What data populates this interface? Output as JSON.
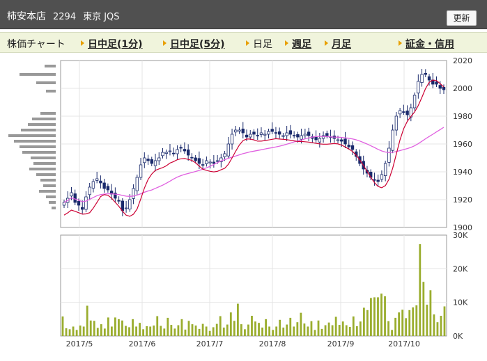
{
  "header": {
    "company_name": "柿安本店",
    "stock_code": "2294",
    "market": "東京 JQS",
    "refresh_label": "更新"
  },
  "tabs": [
    {
      "label": "株価チャート",
      "link": false
    },
    {
      "label": "日中足(1分)",
      "link": true
    },
    {
      "label": "日中足(5分)",
      "link": true
    },
    {
      "label": "日足",
      "link": false
    },
    {
      "label": "週足",
      "link": true
    },
    {
      "label": "月足",
      "link": true
    },
    {
      "label": "証金・信用",
      "link": true
    }
  ],
  "colors": {
    "header_bg": "#505050",
    "tab_bar_bg": "#f0f4dc",
    "tab_arrow": "#e8a000",
    "candle_up": "#ffffff",
    "candle_down": "#1a2a6c",
    "ma_short": "#cc0033",
    "ma_long": "#e060e0",
    "volume_bar": "#9aad2e",
    "volume_profile": "#999999"
  },
  "chart_data": [
    {
      "type": "candlestick",
      "ylim": [
        1900,
        2020
      ],
      "y_ticks": [
        "2020",
        "2000",
        "1980",
        "1960",
        "1940",
        "1920",
        "1900"
      ],
      "closes": [
        1918,
        1921,
        1925,
        1918,
        1916,
        1913,
        1922,
        1929,
        1933,
        1935,
        1932,
        1928,
        1927,
        1924,
        1921,
        1919,
        1912,
        1914,
        1920,
        1928,
        1936,
        1945,
        1950,
        1948,
        1946,
        1948,
        1950,
        1954,
        1954,
        1955,
        1953,
        1956,
        1957,
        1955,
        1952,
        1950,
        1948,
        1946,
        1945,
        1948,
        1947,
        1946,
        1948,
        1950,
        1953,
        1960,
        1967,
        1970,
        1970,
        1968,
        1965,
        1967,
        1967,
        1966,
        1968,
        1967,
        1969,
        1969,
        1968,
        1967,
        1966,
        1968,
        1967,
        1966,
        1965,
        1966,
        1967,
        1966,
        1964,
        1963,
        1964,
        1966,
        1966,
        1965,
        1964,
        1963,
        1962,
        1960,
        1958,
        1956,
        1951,
        1946,
        1942,
        1939,
        1936,
        1934,
        1933,
        1938,
        1946,
        1957,
        1970,
        1980,
        1984,
        1983,
        1981,
        1986,
        1995,
        2005,
        2010,
        2010,
        2006,
        2003,
        2003,
        2000,
        1999
      ],
      "ma_short_range": [
        1908,
        2006
      ],
      "ma_long_range": [
        1918,
        1972
      ],
      "volume_profile_prices": [
        2016,
        2010,
        2004,
        1998,
        1982,
        1978,
        1974,
        1970,
        1966,
        1962,
        1958,
        1954,
        1950,
        1946,
        1942,
        1938,
        1934,
        1930,
        1926,
        1922,
        1918,
        1914
      ]
    },
    {
      "type": "bar",
      "ylim": [
        0,
        30000
      ],
      "y_ticks": [
        "30K",
        "20K",
        "10K",
        "0K"
      ],
      "x_tick_labels": [
        "2017/5",
        "2017/6",
        "2017/7",
        "2017/8",
        "2017/9",
        "2017/10"
      ],
      "values": [
        5800,
        2300,
        2000,
        2800,
        1800,
        3100,
        2800,
        9000,
        4600,
        4500,
        2400,
        3500,
        2200,
        5500,
        2800,
        5500,
        5000,
        4600,
        3000,
        2600,
        5000,
        2800,
        3900,
        2000,
        2900,
        2800,
        3100,
        5900,
        3000,
        2200,
        5400,
        3300,
        2200,
        3200,
        5000,
        1900,
        4500,
        3500,
        3100,
        2100,
        3600,
        2800,
        1500,
        2600,
        3600,
        5900,
        2500,
        3400,
        7000,
        4500,
        9600,
        3500,
        2000,
        3400,
        6000,
        4300,
        3900,
        2500,
        5000,
        2800,
        1800,
        2800,
        4800,
        2500,
        3400,
        5400,
        2800,
        4100,
        6900,
        3700,
        2800,
        4400,
        1800,
        4600,
        2100,
        3200,
        4000,
        3200,
        5700,
        3300,
        4300,
        3200,
        2700,
        5800,
        2900,
        4300,
        8400,
        7700,
        11300,
        11500,
        11500,
        12600,
        11800,
        4400,
        1800,
        5400,
        7000,
        7800,
        5300,
        7700,
        8500,
        9100,
        27300,
        16100,
        9300,
        13600,
        6400,
        4100,
        6000,
        8800
      ]
    }
  ]
}
